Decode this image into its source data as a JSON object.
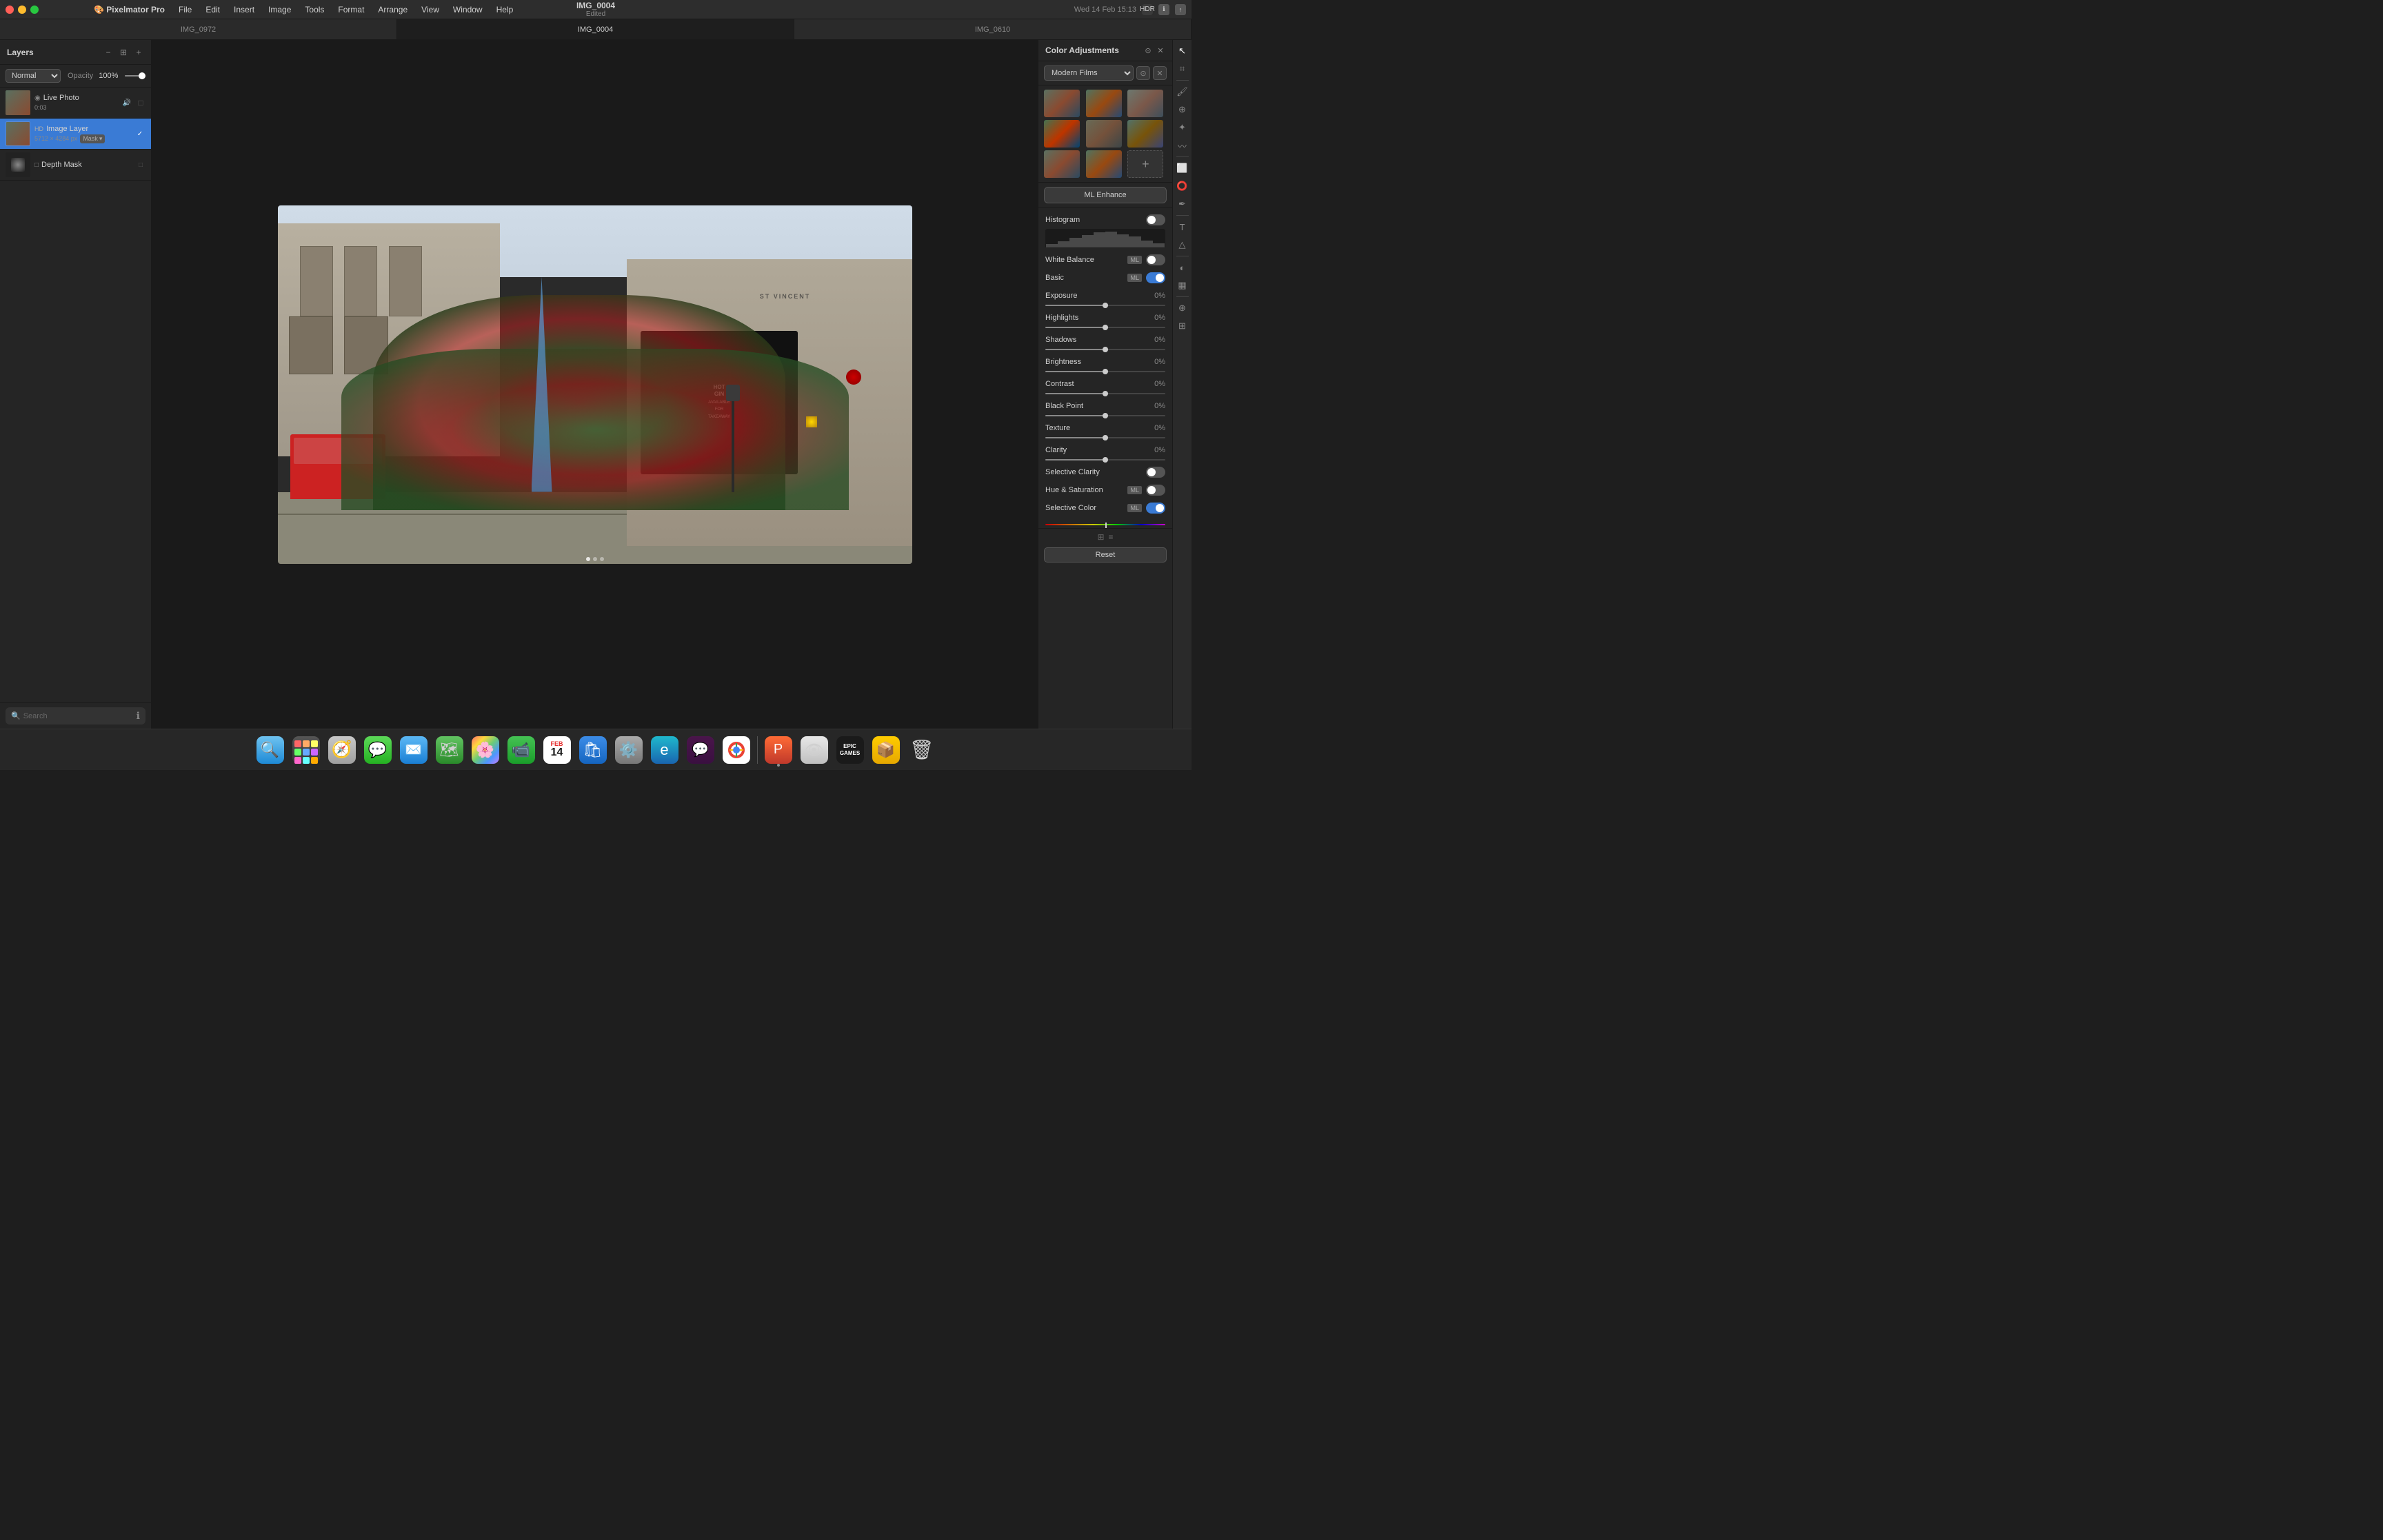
{
  "titlebar": {
    "app_name": "Pixelmator Pro",
    "file_name": "IMG_0004",
    "file_status": "Edited",
    "menu_items": [
      "File",
      "Edit",
      "Insert",
      "Image",
      "Tools",
      "Format",
      "Arrange",
      "View",
      "Window",
      "Help"
    ],
    "time": "Wed 14 Feb  15:13"
  },
  "tabs": [
    {
      "label": "IMG_0972",
      "active": false
    },
    {
      "label": "IMG_0004",
      "active": true
    },
    {
      "label": "IMG_0610",
      "active": false
    }
  ],
  "layers_panel": {
    "title": "Layers",
    "blend_mode": "Normal",
    "opacity_label": "Opacity",
    "opacity_value": "100%",
    "layers": [
      {
        "name": "Live Photo",
        "subtitle": "0:03",
        "type": "live"
      },
      {
        "name": "Image Layer",
        "subtitle": "5712 × 4284 px",
        "type": "image",
        "selected": true,
        "has_mask": true,
        "mask_label": "Mask"
      },
      {
        "name": "Depth Mask",
        "subtitle": "",
        "type": "mask"
      }
    ],
    "search_placeholder": "Search"
  },
  "color_adjustments": {
    "title": "Color Adjustments",
    "preset_label": "Modern Films",
    "ml_enhance_label": "ML Enhance",
    "adjustments": [
      {
        "name": "Histogram",
        "has_toggle": true,
        "toggle_on": false,
        "value": ""
      },
      {
        "name": "White Balance",
        "has_toggle": true,
        "toggle_on": false,
        "has_ml": true,
        "value": ""
      },
      {
        "name": "Basic",
        "has_toggle": true,
        "toggle_on": true,
        "has_ml": true,
        "value": ""
      },
      {
        "name": "Exposure",
        "has_slider": true,
        "value": "0%"
      },
      {
        "name": "Highlights",
        "has_slider": true,
        "value": "0%"
      },
      {
        "name": "Shadows",
        "has_slider": true,
        "value": "0%"
      },
      {
        "name": "Brightness",
        "has_slider": true,
        "value": "0%"
      },
      {
        "name": "Contrast",
        "has_slider": true,
        "value": "0%"
      },
      {
        "name": "Black Point",
        "has_slider": true,
        "value": "0%"
      },
      {
        "name": "Texture",
        "has_slider": true,
        "value": "0%"
      },
      {
        "name": "Clarity",
        "has_slider": true,
        "value": "0%"
      },
      {
        "name": "Selective Clarity",
        "has_toggle": true,
        "toggle_on": false,
        "value": ""
      },
      {
        "name": "Hue & Saturation",
        "has_toggle": true,
        "toggle_on": false,
        "has_ml": true,
        "value": ""
      },
      {
        "name": "Selective Color",
        "has_toggle": true,
        "toggle_on": true,
        "has_ml": true,
        "value": ""
      }
    ],
    "reset_label": "Reset"
  },
  "dock": {
    "items": [
      {
        "label": "Finder",
        "icon": "🔍",
        "type": "finder"
      },
      {
        "label": "Launchpad",
        "icon": "⊞",
        "type": "launchpad"
      },
      {
        "label": "Safari",
        "icon": "🧭",
        "type": "safari"
      },
      {
        "label": "Messages",
        "icon": "💬",
        "type": "messages"
      },
      {
        "label": "Mail",
        "icon": "✉️",
        "type": "mail"
      },
      {
        "label": "Maps",
        "icon": "🗺",
        "type": "maps"
      },
      {
        "label": "Photos",
        "icon": "🌸",
        "type": "photos"
      },
      {
        "label": "FaceTime",
        "icon": "📹",
        "type": "facetime"
      },
      {
        "label": "Calendar",
        "icon": "14",
        "type": "calendar"
      },
      {
        "label": "App Store",
        "icon": "A",
        "type": "appstore"
      },
      {
        "label": "System Settings",
        "icon": "⚙",
        "type": "settings"
      },
      {
        "label": "Edge",
        "icon": "e",
        "type": "edge"
      },
      {
        "label": "Slack",
        "icon": "S",
        "type": "slack"
      },
      {
        "label": "Chrome",
        "icon": "G",
        "type": "chrome"
      },
      {
        "label": "Pixelmator",
        "icon": "P",
        "type": "pixelmator"
      },
      {
        "label": "Preview",
        "icon": "👁",
        "type": "preview"
      },
      {
        "label": "Epic Games",
        "icon": "EPIC",
        "type": "epic"
      },
      {
        "label": "The Unarchiver",
        "icon": "📦",
        "type": "winzip"
      },
      {
        "label": "Trash",
        "icon": "🗑",
        "type": "trash"
      }
    ]
  }
}
